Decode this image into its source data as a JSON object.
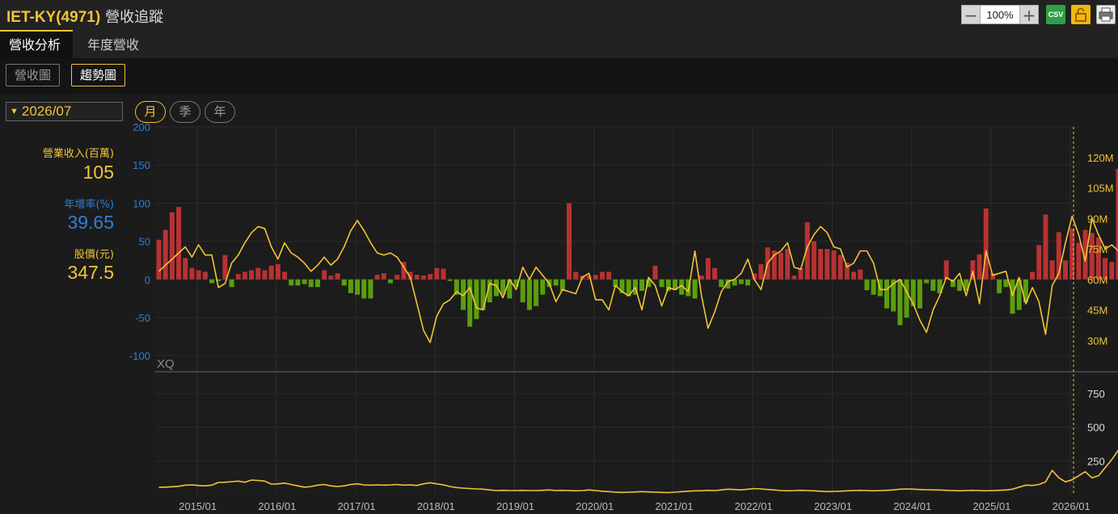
{
  "header": {
    "stock_code": "IET-KY(4971)",
    "page_name": "營收追蹤",
    "zoom": "100%",
    "csv_label": "CSV"
  },
  "tabs": [
    {
      "label": "營收分析",
      "active": true
    },
    {
      "label": "年度營收",
      "active": false
    }
  ],
  "view_toggle": [
    {
      "label": "營收圖",
      "active": false
    },
    {
      "label": "趨勢圖",
      "active": true
    }
  ],
  "date_select": "2026/07",
  "period_buttons": [
    {
      "label": "月",
      "active": true
    },
    {
      "label": "季",
      "active": false
    },
    {
      "label": "年",
      "active": false
    }
  ],
  "info": {
    "revenue_label": "營業收入(百萬)",
    "revenue_value": "105",
    "yoy_label": "年增率(%)",
    "yoy_value": "39.65",
    "price_label": "股價(元)",
    "price_value": "347.5"
  },
  "colors": {
    "accent": "#f3c436",
    "positive_bar": "#b83232",
    "negative_bar": "#5a9e0d",
    "left_axis": "#2e7fd6",
    "line": "#f3c436"
  },
  "watermark": "XQ",
  "chart_data": [
    {
      "type": "bar",
      "name": "yoy_growth",
      "unit": "%",
      "start": "2014/07",
      "ylim": [
        -120,
        200
      ],
      "yticks": [
        200,
        150,
        100,
        50,
        0,
        -50,
        -100
      ],
      "values": [
        52,
        65,
        88,
        95,
        28,
        15,
        12,
        10,
        -5,
        -2,
        32,
        -10,
        7,
        10,
        12,
        15,
        12,
        18,
        20,
        10,
        -8,
        -8,
        -6,
        -10,
        -10,
        12,
        5,
        8,
        -8,
        -18,
        -20,
        -25,
        -25,
        6,
        8,
        -5,
        6,
        23,
        10,
        6,
        5,
        7,
        15,
        14,
        -2,
        -20,
        -40,
        -62,
        -52,
        -40,
        -30,
        -22,
        -20,
        -25,
        -10,
        -30,
        -40,
        -35,
        -20,
        -10,
        -8,
        -15,
        100,
        10,
        5,
        5,
        6,
        10,
        10,
        -10,
        -18,
        -22,
        -20,
        -15,
        -10,
        18,
        -10,
        -15,
        -14,
        -20,
        -22,
        -25,
        5,
        28,
        15,
        -10,
        -12,
        -8,
        -6,
        -8,
        8,
        20,
        42,
        38,
        35,
        40,
        5,
        15,
        75,
        50,
        40,
        40,
        38,
        32,
        22,
        10,
        13,
        -14,
        -20,
        -22,
        -38,
        -42,
        -60,
        -50,
        -35,
        -38,
        -5,
        -15,
        -18,
        25,
        -10,
        -15,
        -15,
        25,
        33,
        93,
        8,
        -18,
        -10,
        -45,
        -40,
        -30,
        10,
        45,
        85,
        25,
        62,
        25,
        67,
        48,
        65,
        61,
        55,
        28,
        23,
        145,
        88,
        80,
        29,
        25,
        22,
        8,
        15,
        0,
        -10,
        38
      ]
    },
    {
      "type": "line",
      "name": "monthly_revenue",
      "unit": "M",
      "ylim": [
        15,
        135
      ],
      "yticks": [
        120,
        105,
        90,
        75,
        60,
        45,
        30
      ],
      "tick_suffix": "M",
      "values": [
        64,
        67,
        70,
        73,
        76,
        71,
        77,
        72,
        72,
        56,
        58,
        68,
        72,
        78,
        83,
        86,
        85,
        76,
        70,
        78,
        73,
        71,
        68,
        64,
        67,
        71,
        67,
        70,
        76,
        84,
        89,
        84,
        78,
        73,
        72,
        73,
        71,
        66,
        61,
        48,
        35,
        29,
        42,
        48,
        50,
        54,
        52,
        56,
        46,
        45,
        58,
        57,
        51,
        60,
        55,
        66,
        60,
        66,
        62,
        58,
        49,
        55,
        54,
        53,
        61,
        63,
        50,
        50,
        45,
        57,
        54,
        52,
        56,
        45,
        61,
        57,
        47,
        56,
        55,
        57,
        54,
        74,
        52,
        36,
        44,
        54,
        59,
        60,
        63,
        70,
        60,
        55,
        68,
        72,
        74,
        78,
        66,
        65,
        76,
        82,
        86,
        83,
        76,
        75,
        66,
        68,
        74,
        74,
        68,
        55,
        55,
        58,
        60,
        54,
        48,
        40,
        34,
        45,
        52,
        61,
        59,
        63,
        52,
        64,
        48,
        74,
        62,
        63,
        64,
        52,
        61,
        48,
        56,
        49,
        33,
        57,
        63,
        78,
        91,
        82,
        69,
        90,
        82,
        75,
        77,
        74,
        79,
        84,
        100,
        108,
        110,
        111,
        111,
        109,
        105,
        77,
        71,
        103
      ],
      "x_labels": [
        "2015/01",
        "2016/01",
        "2017/01",
        "2018/01",
        "2019/01",
        "2020/01",
        "2021/01",
        "2022/01",
        "2023/01",
        "2024/01",
        "2025/01",
        "2026/01"
      ]
    },
    {
      "type": "line",
      "name": "stock_price",
      "unit": "元",
      "ylim": [
        0,
        900
      ],
      "yticks": [
        750,
        500,
        250
      ],
      "values": [
        55,
        55,
        58,
        62,
        70,
        72,
        68,
        65,
        70,
        90,
        92,
        96,
        100,
        92,
        108,
        105,
        100,
        78,
        80,
        85,
        75,
        65,
        55,
        60,
        70,
        75,
        65,
        60,
        65,
        75,
        80,
        72,
        70,
        72,
        70,
        72,
        75,
        70,
        72,
        68,
        80,
        88,
        80,
        72,
        60,
        52,
        48,
        45,
        42,
        40,
        35,
        30,
        32,
        30,
        30,
        32,
        30,
        30,
        32,
        35,
        30,
        32,
        30,
        28,
        30,
        35,
        30,
        25,
        22,
        18,
        16,
        18,
        20,
        22,
        20,
        18,
        16,
        15,
        18,
        22,
        25,
        28,
        28,
        32,
        30,
        35,
        40,
        38,
        35,
        40,
        45,
        42,
        38,
        35,
        30,
        28,
        30,
        32,
        30,
        28,
        25,
        22,
        24,
        25,
        28,
        30,
        32,
        30,
        28,
        30,
        32,
        35,
        40,
        42,
        40,
        38,
        36,
        35,
        34,
        32,
        30,
        28,
        30,
        32,
        30,
        28,
        30,
        32,
        34,
        40,
        55,
        70,
        68,
        75,
        95,
        180,
        125,
        95,
        110,
        140,
        170,
        125,
        140,
        200,
        260,
        330,
        410,
        520,
        640,
        760,
        735,
        500,
        340,
        318,
        318,
        318,
        318,
        318
      ]
    }
  ]
}
